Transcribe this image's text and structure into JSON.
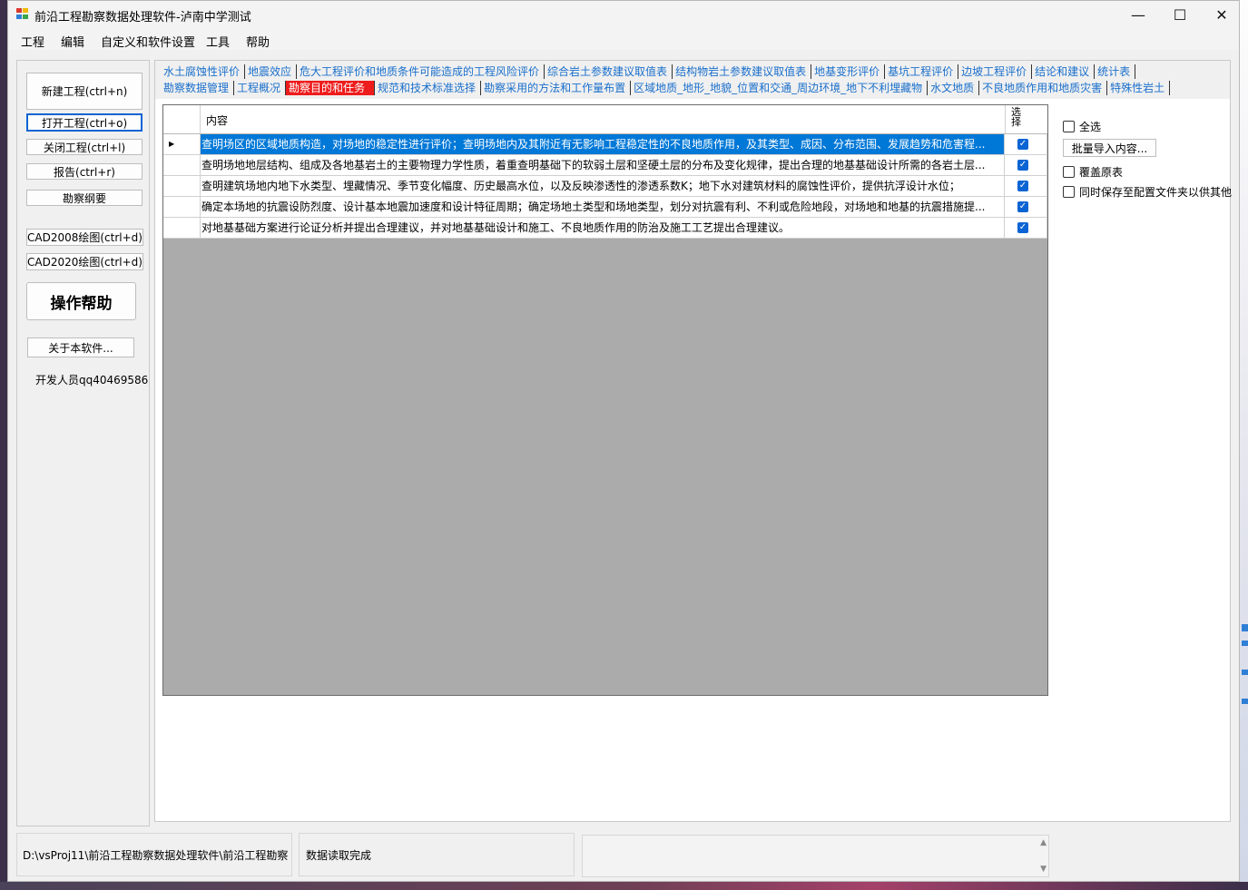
{
  "window": {
    "title": "前沿工程勘察数据处理软件-泸南中学测试",
    "controls": {
      "minimize": "—",
      "maximize": "☐",
      "close": "✕"
    }
  },
  "menu": [
    "工程",
    "编辑",
    "自定义和软件设置",
    "工具",
    "帮助"
  ],
  "left_panel": {
    "buttons": {
      "new_project": "新建工程(ctrl+n)",
      "open_project": "打开工程(ctrl+o)",
      "close_project": "关闭工程(ctrl+l)",
      "report": "报告(ctrl+r)",
      "outline": "勘察纲要",
      "cad2008": "CAD2008绘图(ctrl+d)",
      "cad2020": "CAD2020绘图(ctrl+d)",
      "help": "操作帮助",
      "about": "关于本软件..."
    },
    "developer": "开发人员qq40469586"
  },
  "tabs": {
    "row1": [
      "水土腐蚀性评价",
      "地震效应",
      "危大工程评价和地质条件可能造成的工程风险评价",
      "综合岩土参数建议取值表",
      "结构物岩土参数建议取值表",
      "地基变形评价",
      "基坑工程评价",
      "边坡工程评价",
      "结论和建议",
      "统计表"
    ],
    "row2": [
      "勘察数据管理",
      "工程概况",
      "勘察目的和任务",
      "规范和技术标准选择",
      "勘察采用的方法和工作量布置",
      "区域地质_地形_地貌_位置和交通_周边环境_地下不利埋藏物",
      "水文地质",
      "不良地质作用和地质灾害",
      "特殊性岩土"
    ],
    "active": "勘察目的和任务"
  },
  "grid": {
    "columns": {
      "content": "内容",
      "select": "选择"
    },
    "rows": [
      {
        "content": "查明场区的区域地质构造，对场地的稳定性进行评价；查明场地内及其附近有无影响工程稳定性的不良地质作用，及其类型、成因、分布范围、发展趋势和危害程...",
        "checked": true,
        "selected": true
      },
      {
        "content": "查明场地地层结构、组成及各地基岩土的主要物理力学性质，着重查明基础下的软弱土层和坚硬土层的分布及变化规律，提出合理的地基基础设计所需的各岩土层...",
        "checked": true,
        "selected": false
      },
      {
        "content": "查明建筑场地内地下水类型、埋藏情况、季节变化幅度、历史最高水位，以及反映渗透性的渗透系数K；地下水对建筑材料的腐蚀性评价，提供抗浮设计水位；",
        "checked": true,
        "selected": false
      },
      {
        "content": "确定本场地的抗震设防烈度、设计基本地震加速度和设计特征周期；确定场地土类型和场地类型，划分对抗震有利、不利或危险地段，对场地和地基的抗震措施提...",
        "checked": true,
        "selected": false
      },
      {
        "content": "对地基基础方案进行论证分析并提出合理建议，并对地基基础设计和施工、不良地质作用的防治及施工工艺提出合理建议。",
        "checked": true,
        "selected": false
      }
    ]
  },
  "options": {
    "select_all": "全选",
    "batch_import": "批量导入内容...",
    "overwrite": "覆盖原表",
    "save_config": "同时保存至配置文件夹以供其他"
  },
  "status": {
    "path": "D:\\vsProj11\\前沿工程勘察数据处理软件\\前沿工程勘察",
    "message": "数据读取完成",
    "extra": ""
  }
}
